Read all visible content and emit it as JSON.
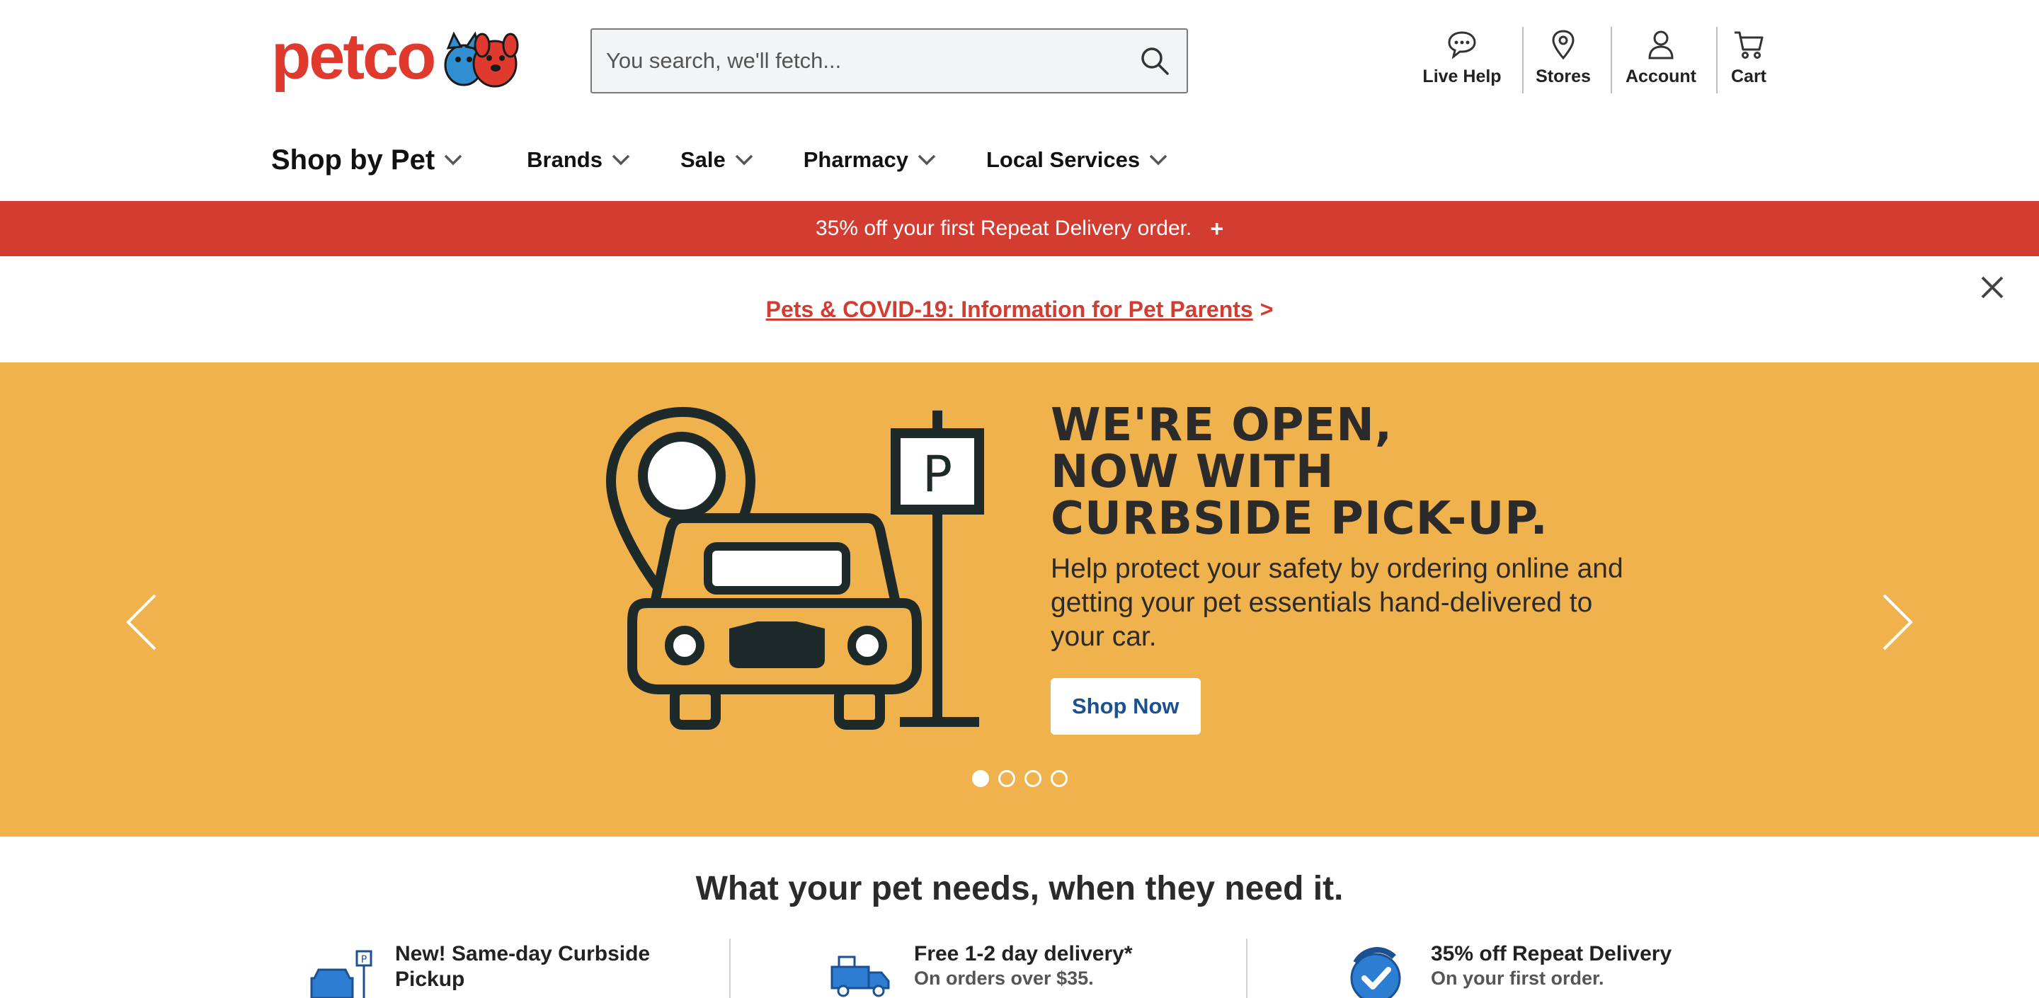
{
  "header": {
    "logo_text": "petco",
    "search": {
      "placeholder": "You search, we'll fetch..."
    },
    "utility": [
      {
        "label": "Live Help",
        "icon": "chat-bubble-icon"
      },
      {
        "label": "Stores",
        "icon": "map-pin-icon"
      },
      {
        "label": "Account",
        "icon": "user-icon"
      },
      {
        "label": "Cart",
        "icon": "cart-icon"
      }
    ]
  },
  "nav": {
    "items": [
      {
        "label": "Shop by Pet"
      },
      {
        "label": "Brands"
      },
      {
        "label": "Sale"
      },
      {
        "label": "Pharmacy"
      },
      {
        "label": "Local Services"
      }
    ]
  },
  "promo": {
    "text": "35% off your first Repeat Delivery order.",
    "plus": "+"
  },
  "notice": {
    "link": "Pets & COVID-19: Information for Pet Parents",
    "suffix": ">"
  },
  "hero": {
    "title_lines": [
      "WE'RE OPEN,",
      "NOW WITH",
      "CURBSIDE PICK-UP."
    ],
    "body": "Help protect your safety by ordering online and getting your pet essentials hand-delivered to your car.",
    "cta": "Shop Now",
    "slide_count": 4,
    "active_slide": 1,
    "sign_letter": "P",
    "background": "#f0b24c"
  },
  "needs": {
    "title": "What your pet needs, when they need it.",
    "features": [
      {
        "title": "New! Same-day Curbside Pickup",
        "subtitle": ""
      },
      {
        "title": "Free 1-2 day delivery*",
        "subtitle": "On orders over $35."
      },
      {
        "title": "35% off Repeat Delivery",
        "subtitle": "On your first order."
      }
    ]
  },
  "colors": {
    "brand_red": "#d23c31",
    "link_blue": "#1b5190",
    "hero_yellow": "#f0b24c"
  }
}
